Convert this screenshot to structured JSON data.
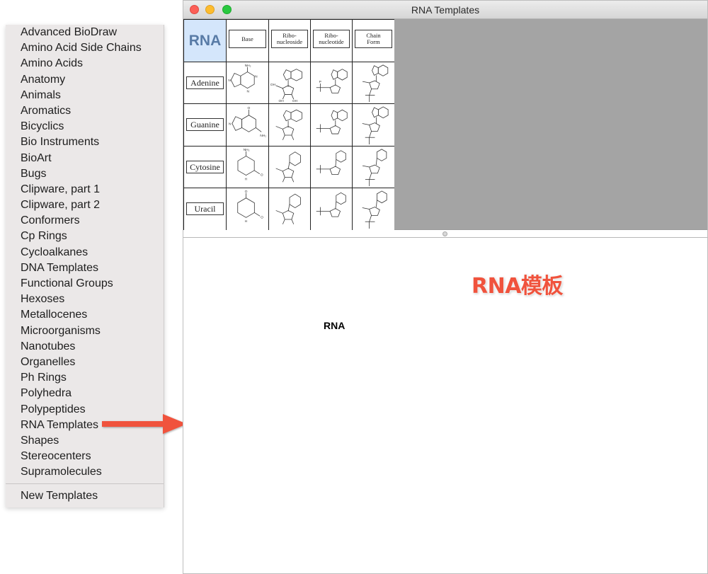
{
  "menu": {
    "items": [
      "Advanced BioDraw",
      "Amino Acid Side Chains",
      "Amino Acids",
      "Anatomy",
      "Animals",
      "Aromatics",
      "Bicyclics",
      "Bio Instruments",
      "BioArt",
      "Bugs",
      "Clipware, part 1",
      "Clipware, part 2",
      "Conformers",
      "Cp Rings",
      "Cycloalkanes",
      "DNA Templates",
      "Functional Groups",
      "Hexoses",
      "Metallocenes",
      "Microorganisms",
      "Nanotubes",
      "Organelles",
      "Ph Rings",
      "Polyhedra",
      "Polypeptides",
      "RNA Templates",
      "Shapes",
      "Stereocenters",
      "Supramolecules"
    ],
    "new_templates": "New Templates"
  },
  "window": {
    "title": "RNA Templates",
    "corner_label": "RNA",
    "column_headers": [
      "Base",
      "Ribo-\nnucleoside",
      "Ribo-\nnucleotide",
      "Chain\nForm"
    ],
    "row_labels": [
      "Adenine",
      "Guanine",
      "Cytosine",
      "Uracil"
    ],
    "atom_labels": {
      "nh2": "NH₂",
      "o": "O",
      "n": "N",
      "h": "H",
      "oh": "OH",
      "p": "P"
    },
    "canvas_label": "RNA"
  },
  "annotation": {
    "text": "RNA模板",
    "color": "#f0533d"
  },
  "icons": {
    "close": "close-button-icon",
    "minimize": "minimize-button-icon",
    "zoom": "zoom-button-icon",
    "arrow": "red-arrow-icon"
  }
}
